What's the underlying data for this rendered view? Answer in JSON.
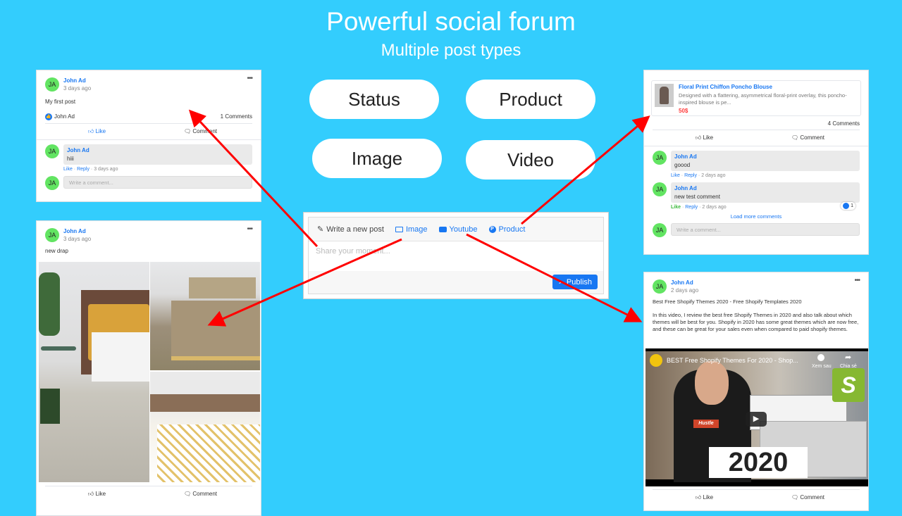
{
  "hero": {
    "title": "Powerful social forum",
    "subtitle": "Multiple post types"
  },
  "post_types": [
    "Status",
    "Product",
    "Image",
    "Video"
  ],
  "composer": {
    "tabs": [
      {
        "label": "Write a new post",
        "icon": "pencil-icon"
      },
      {
        "label": "Image",
        "icon": "image-icon"
      },
      {
        "label": "Youtube",
        "icon": "youtube-icon"
      },
      {
        "label": "Product",
        "icon": "product-icon"
      }
    ],
    "placeholder": "Share your moment...",
    "publish_label": "Publish"
  },
  "status_post": {
    "author": "John Ad",
    "initials": "JA",
    "time": "3 days ago",
    "text": "My first post",
    "liked_by": "John Ad",
    "comment_count": "1 Comments",
    "like_label": "Like",
    "comment_label": "Comment",
    "comments": [
      {
        "author": "John Ad",
        "initials": "JA",
        "text": "hiii",
        "like": "Like",
        "reply": "Reply",
        "time": "3 days ago"
      }
    ],
    "write_placeholder": "Write a comment..."
  },
  "image_post": {
    "author": "John Ad",
    "initials": "JA",
    "time": "3 days ago",
    "text": "new drap",
    "like_label": "Like",
    "comment_label": "Comment"
  },
  "product_post": {
    "product_name": "Floral Print Chiffon Poncho Blouse",
    "product_desc": "Designed with a flattering, asymmetrical floral-print overlay, this poncho-inspired blouse is pe...",
    "price": "50$",
    "comment_count": "4 Comments",
    "like_label": "Like",
    "comment_label": "Comment",
    "comments": [
      {
        "author": "John Ad",
        "initials": "JA",
        "text": "goood",
        "like": "Like",
        "reply": "Reply",
        "time": "2 days ago"
      },
      {
        "author": "John Ad",
        "initials": "JA",
        "text": "new test comment",
        "like": "Like",
        "reply": "Reply",
        "time": "2 days ago",
        "reactions": "1"
      }
    ],
    "load_more": "Load more comments",
    "write_placeholder": "Write a comment..."
  },
  "video_post": {
    "author": "John Ad",
    "initials": "JA",
    "time": "2 days ago",
    "title": "Best Free Shopify Themes 2020 - Free Shopify Templates 2020",
    "desc": "In this video, I review the best free Shopify Themes in 2020 and also talk about which themes will be best for you. Shopify in 2020 has some great themes which are now free, and these can be great for your sales even when compared to paid shopify themes.",
    "video_title": "BEST Free Shopify Themes For 2020 - Shop...",
    "watch_later": "Xem sau",
    "share": "Chia sẻ",
    "year_overlay": "2020",
    "shirt_text": "Hustle",
    "like_label": "Like",
    "comment_label": "Comment"
  },
  "colors": {
    "background": "#33cdfd",
    "accent": "#1877f2",
    "arrow": "#ff0000",
    "price": "#ff3b3b"
  }
}
